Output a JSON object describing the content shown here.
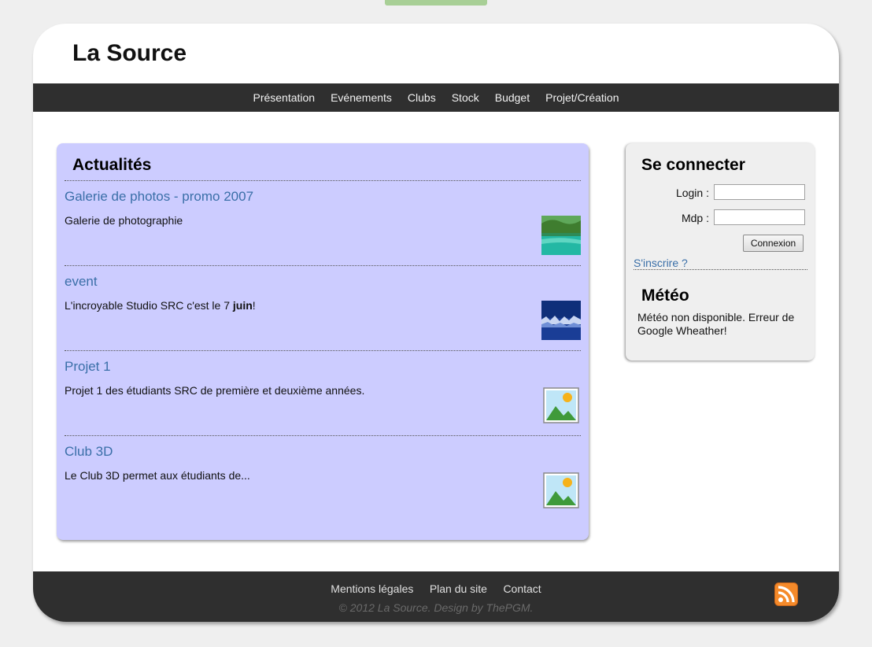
{
  "site": {
    "title": "La Source"
  },
  "nav": [
    {
      "label": "Présentation"
    },
    {
      "label": "Evénements"
    },
    {
      "label": "Clubs"
    },
    {
      "label": "Stock"
    },
    {
      "label": "Budget"
    },
    {
      "label": "Projet/Création"
    }
  ],
  "news": {
    "heading": "Actualités",
    "items": [
      {
        "title": "Galerie de photos - promo 2007",
        "text": "Galerie de photographie",
        "thumb": "lagoon-photo"
      },
      {
        "title": "event",
        "text_before": "L'incroyable Studio SRC c'est le 7 ",
        "text_bold": "juin",
        "text_after": "!",
        "thumb": "blue-water-photo"
      },
      {
        "title": "Projet 1",
        "text": "Projet 1 des étudiants SRC de première et deuxième années.",
        "thumb": "image-placeholder-icon"
      },
      {
        "title": "Club 3D",
        "text": "Le Club 3D permet aux étudiants de...",
        "thumb": "image-placeholder-icon"
      }
    ]
  },
  "login": {
    "heading": "Se connecter",
    "login_label": "Login :",
    "login_value": "",
    "password_label": "Mdp :",
    "password_value": "",
    "submit_label": "Connexion",
    "signup_label": "S'inscrire ?"
  },
  "weather": {
    "heading": "Météo",
    "message": "Météo non disponible. Erreur de Google Wheather!"
  },
  "footer": {
    "links": [
      {
        "label": "Mentions légales"
      },
      {
        "label": "Plan du site"
      },
      {
        "label": "Contact"
      }
    ],
    "copyright": "© 2012 La Source. Design by ThePGM."
  },
  "colors": {
    "background": "#efefef",
    "nav_bar": "#2f2f2f",
    "news_panel": "#ccccff",
    "link": "#3a6fa8",
    "accent_tab": "#a8cf96",
    "rss": "#f58a2a"
  }
}
